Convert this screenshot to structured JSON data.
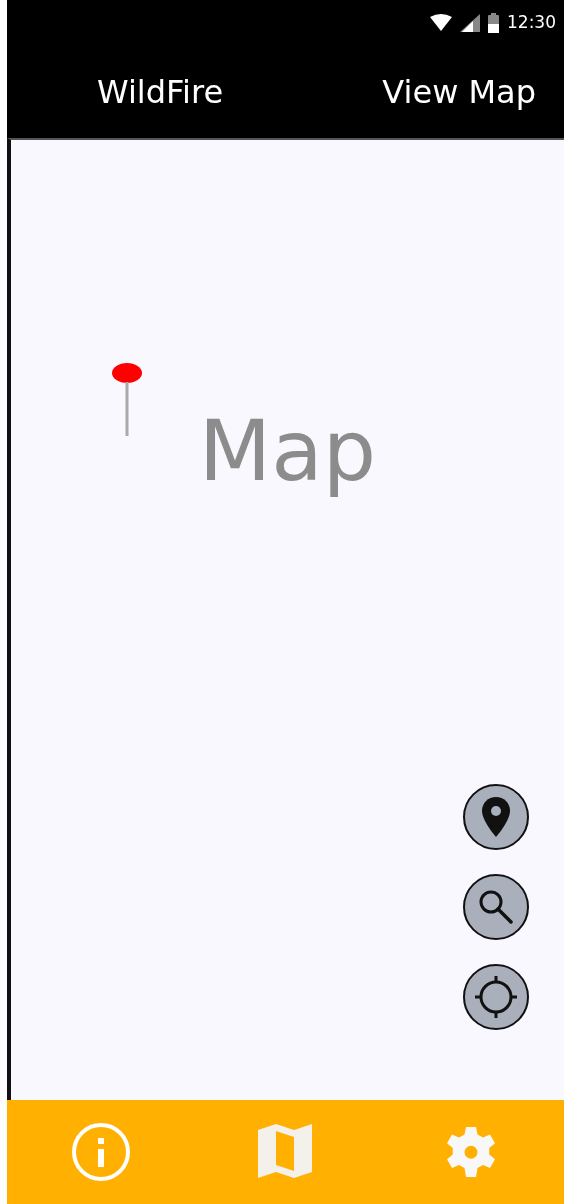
{
  "status_bar": {
    "time": "12:30"
  },
  "app_bar": {
    "title": "WildFire",
    "action": "View Map"
  },
  "map": {
    "label": "Map",
    "controls": [
      {
        "kind": "pin"
      },
      {
        "kind": "search"
      },
      {
        "kind": "locate"
      }
    ]
  },
  "bottom_nav": [
    {
      "kind": "info"
    },
    {
      "kind": "map"
    },
    {
      "kind": "settings"
    }
  ]
}
